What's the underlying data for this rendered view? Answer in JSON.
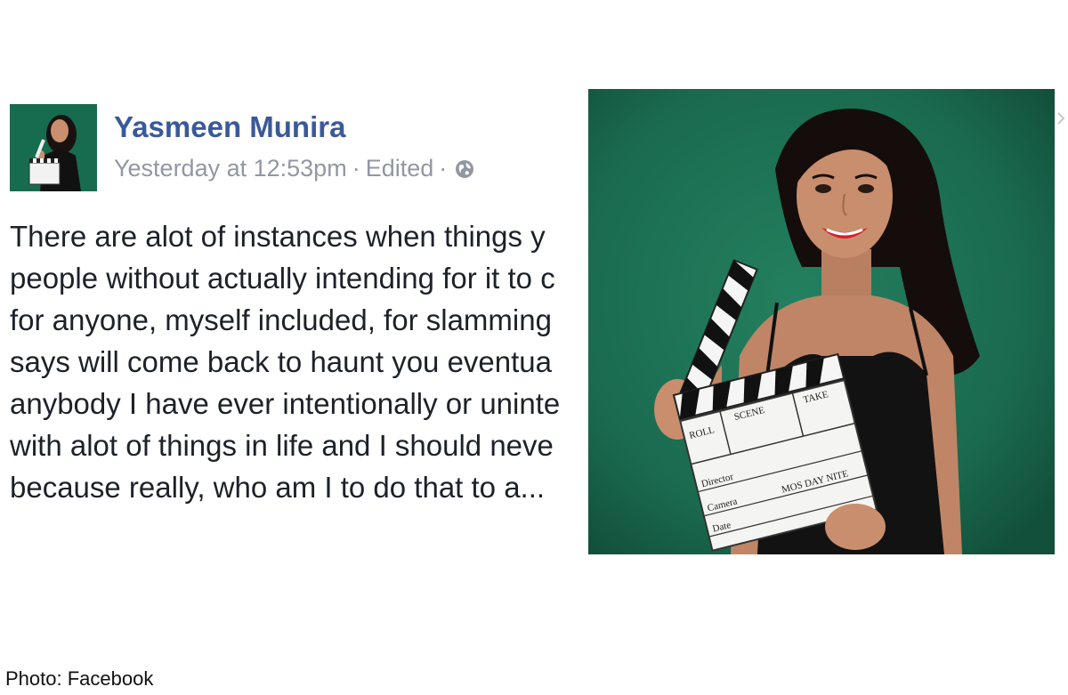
{
  "post": {
    "author_name": "Yasmeen Munira",
    "timestamp": "Yesterday at 12:53pm",
    "separator": "·",
    "edited_label": "Edited",
    "privacy_icon": "globe-icon",
    "body_lines": [
      "There are alot of instances when things y",
      "people without actually intending for it to c",
      "for anyone, myself included, for slamming",
      "says will come back to haunt you eventua",
      "anybody I have ever intentionally or uninte",
      "with alot of things in life and I should neve",
      "because really, who am I to do that to a..."
    ]
  },
  "photo": {
    "clapperboard": {
      "roll": "ROLL",
      "scene": "SCENE",
      "take": "TAKE",
      "director": "Director",
      "camera": "Camera",
      "date": "Date",
      "mos_day_nite": "MOS  DAY  NITE"
    },
    "background_color": "#1b6e52"
  },
  "caption": {
    "credit": "Photo: Facebook"
  },
  "colors": {
    "name_link": "#3b5998",
    "meta_gray": "#9197a3",
    "body_text": "#1d2129"
  }
}
